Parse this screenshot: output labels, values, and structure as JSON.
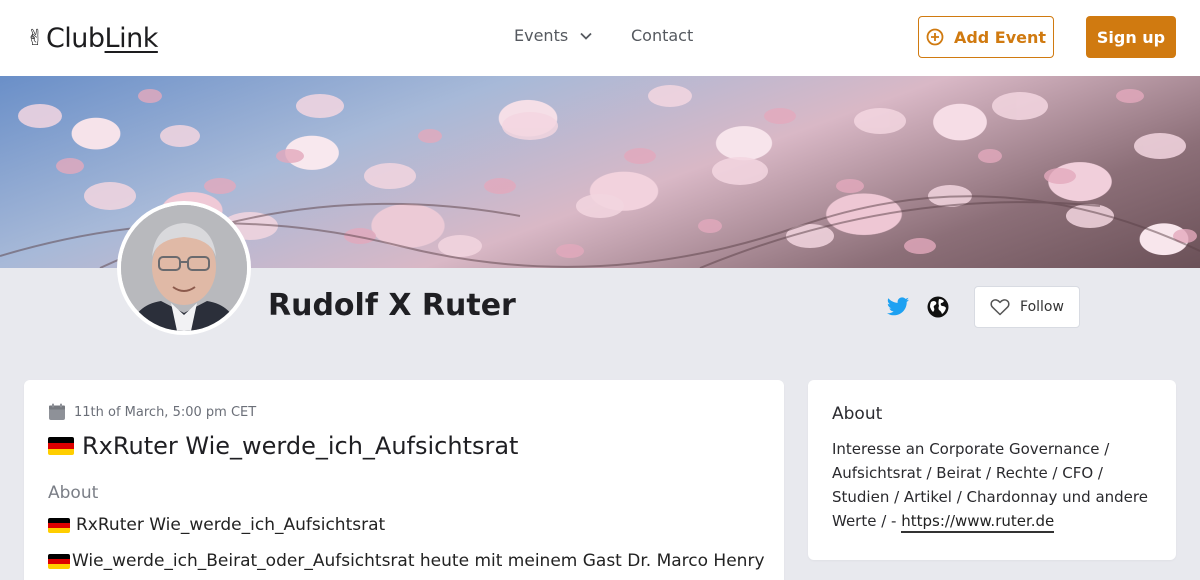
{
  "header": {
    "logo_emoji": "✌",
    "logo_text_a": "Club",
    "logo_text_b": "Link",
    "nav_events": "Events",
    "nav_contact": "Contact",
    "add_event_label": "Add Event",
    "signup_label": "Sign up"
  },
  "profile": {
    "name": "Rudolf X Ruter",
    "follow_label": "Follow",
    "social_icons": [
      "twitter-icon",
      "globe-icon"
    ]
  },
  "event": {
    "date": "11th of March, 5:00 pm CET",
    "title": "RxRuter Wie_werde_ich_Aufsichtsrat",
    "about_label": "About",
    "line1": "RxRuter Wie_werde_ich_Aufsichtsrat",
    "line2": "Wie_werde_ich_Beirat_oder_Aufsichtsrat heute mit meinem Gast Dr. Marco Henry"
  },
  "about": {
    "title": "About",
    "text": "Interesse an Corporate Governance / Aufsichtsrat / Beirat / Rechte / CFO / Studien / Artikel / Chardonnay und andere Werte / - ",
    "link": "https://www.ruter.de"
  },
  "colors": {
    "accent": "#d07a10",
    "twitter": "#1da1f2",
    "page_bg": "#e8e9ee",
    "flag_black": "#000000",
    "flag_red": "#dd0000",
    "flag_gold": "#ffce00"
  }
}
